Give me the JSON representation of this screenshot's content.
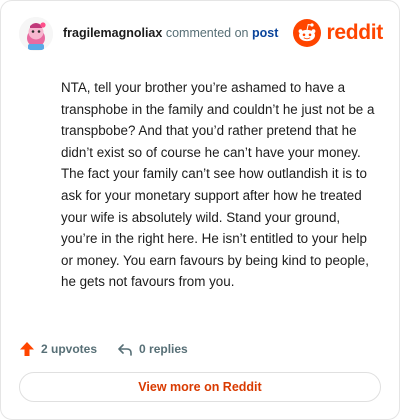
{
  "header": {
    "username": "fragilemagnoliax",
    "commented_on": "commented on",
    "post_link": "post",
    "brand_name": "reddit"
  },
  "comment": {
    "text": "NTA, tell your brother you’re ashamed to have a transphobe in the family and couldn’t he just not be a transpbobe? And that you’d rather pretend that he didn’t exist so of course he can’t have your money. The fact your family can’t see how outlandish it is to ask for your monetary support after how he treated your wife is absolutely wild. Stand your ground, you’re in the right here. He isn’t entitled to your help or money. You earn favours by being kind to people, he gets not favours from you."
  },
  "actions": {
    "upvotes": "2 upvotes",
    "replies": "0 replies"
  },
  "footer": {
    "view_more": "View more on Reddit"
  },
  "colors": {
    "brand": "#ff4500",
    "link": "#0a449b",
    "view_more": "#d93a00",
    "muted": "#576f76"
  }
}
